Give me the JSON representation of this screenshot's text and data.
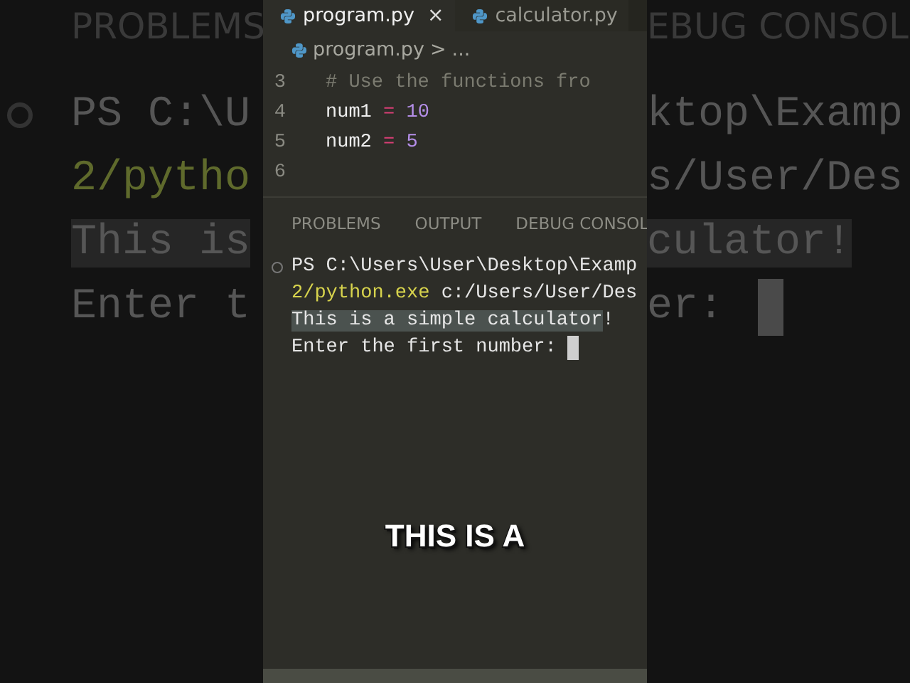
{
  "backdrop_left": {
    "heading": "PROBLEMS",
    "lines": [
      {
        "text": "PS C:\\U",
        "kind": "plain",
        "prompt": true
      },
      {
        "text": "2/pytho",
        "kind": "path",
        "prompt": false
      },
      {
        "text": "This is",
        "kind": "highlight",
        "prompt": false
      },
      {
        "text": "Enter t",
        "kind": "plain",
        "prompt": false
      }
    ]
  },
  "backdrop_right": {
    "heading": "EBUG CONSOL",
    "lines": [
      {
        "text": "ktop\\Examp",
        "kind": "plain",
        "cursor": false
      },
      {
        "text": "s/User/Des",
        "kind": "plain",
        "cursor": false
      },
      {
        "text": "culator!",
        "kind": "highlight",
        "cursor": false
      },
      {
        "text": "er:",
        "kind": "plain",
        "cursor": true
      }
    ]
  },
  "editor": {
    "tabs": [
      {
        "label": "program.py",
        "selected": true,
        "close": "×"
      },
      {
        "label": "calculator.py",
        "selected": false
      }
    ],
    "breadcrumb": {
      "file": "program.py",
      "separator": ">",
      "rest": "..."
    },
    "lines": [
      {
        "number": "3",
        "tokens": [
          {
            "text": "# Use the functions fro",
            "kind": "comment"
          }
        ]
      },
      {
        "number": "4",
        "tokens": [
          {
            "text": "num1",
            "kind": "ident"
          },
          {
            "text": " = ",
            "kind": "op"
          },
          {
            "text": "10",
            "kind": "number"
          }
        ]
      },
      {
        "number": "5",
        "tokens": [
          {
            "text": "num2",
            "kind": "ident"
          },
          {
            "text": " = ",
            "kind": "op"
          },
          {
            "text": "5",
            "kind": "number"
          }
        ]
      },
      {
        "number": "6"
      }
    ]
  },
  "panel": {
    "tabs": [
      {
        "label": "PROBLEMS",
        "selected": false
      },
      {
        "label": "OUTPUT",
        "selected": false
      },
      {
        "label": "DEBUG CONSOL",
        "selected": false
      }
    ],
    "terminal": [
      {
        "prompt": true,
        "cursor": false,
        "segments": [
          {
            "text": "PS C:\\Users\\User\\Desktop\\Examp",
            "kind": "plain"
          }
        ]
      },
      {
        "prompt": false,
        "cursor": false,
        "segments": [
          {
            "text": "2/python.exe",
            "kind": "path"
          },
          {
            "text": " c:/Users/User/Des",
            "kind": "plain"
          }
        ]
      },
      {
        "prompt": false,
        "cursor": false,
        "segments": [
          {
            "text": "This is a simple calculator",
            "kind": "highlight"
          },
          {
            "text": "!",
            "kind": "plain"
          }
        ]
      },
      {
        "prompt": false,
        "cursor": true,
        "segments": [
          {
            "text": "Enter the first number: ",
            "kind": "plain"
          }
        ]
      }
    ]
  },
  "caption": "THIS IS A"
}
